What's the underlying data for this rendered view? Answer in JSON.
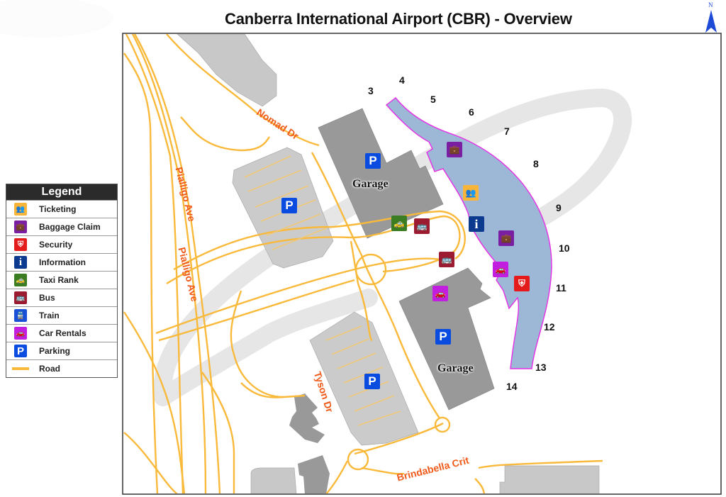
{
  "title": "Canberra International Airport (CBR) - Overview",
  "compass": {
    "label": "N",
    "icon": "north-arrow-icon"
  },
  "colors": {
    "road": "#f9b93a",
    "terminal_fill": "#9db8d6",
    "terminal_outline": "#e62ee6",
    "garage": "#999999",
    "parking_lot": "#cccccc",
    "road_label": "#f05a1a",
    "ticketing": "#f9b43a",
    "baggage": "#7a1fa2",
    "security": "#e31b1b",
    "information": "#0b3a8e",
    "taxi": "#3b7d23",
    "bus": "#9b1b30",
    "train": "#1a4fd8",
    "car_rental": "#c21ee0",
    "parking": "#0a4ce0"
  },
  "legend": {
    "title": "Legend",
    "items": [
      {
        "label": "Ticketing",
        "icon": "ticketing-icon",
        "glyph": "👥"
      },
      {
        "label": "Baggage Claim",
        "icon": "baggage-claim-icon",
        "glyph": "💼"
      },
      {
        "label": "Security",
        "icon": "security-icon",
        "glyph": "⛨"
      },
      {
        "label": "Information",
        "icon": "information-icon",
        "glyph": "i"
      },
      {
        "label": "Taxi Rank",
        "icon": "taxi-icon",
        "glyph": "🚕"
      },
      {
        "label": "Bus",
        "icon": "bus-icon",
        "glyph": "🚌"
      },
      {
        "label": "Train",
        "icon": "train-icon",
        "glyph": "🚆"
      },
      {
        "label": "Car Rentals",
        "icon": "car-rental-icon",
        "glyph": "🚗"
      },
      {
        "label": "Parking",
        "icon": "parking-icon",
        "glyph": "P"
      },
      {
        "label": "Road",
        "icon": "road-icon",
        "glyph": ""
      }
    ]
  },
  "gates": [
    "3",
    "4",
    "5",
    "6",
    "7",
    "8",
    "9",
    "10",
    "11",
    "12",
    "13",
    "14"
  ],
  "garages": [
    "Garage",
    "Garage"
  ],
  "roads": [
    "Nomad Dr",
    "Pialligo Ave",
    "Pialligo Ave",
    "Tyson Dr",
    "Brindabella Crit"
  ],
  "pois": [
    {
      "type": "parking",
      "glyph": "P"
    },
    {
      "type": "parking",
      "glyph": "P"
    },
    {
      "type": "parking",
      "glyph": "P"
    },
    {
      "type": "parking",
      "glyph": "P"
    },
    {
      "type": "baggage",
      "glyph": "💼"
    },
    {
      "type": "ticketing",
      "glyph": "👥"
    },
    {
      "type": "information",
      "glyph": "i"
    },
    {
      "type": "baggage",
      "glyph": "💼"
    },
    {
      "type": "car_rental",
      "glyph": "🚗"
    },
    {
      "type": "security",
      "glyph": "⛨"
    },
    {
      "type": "taxi",
      "glyph": "🚕"
    },
    {
      "type": "bus",
      "glyph": "🚌"
    },
    {
      "type": "bus",
      "glyph": "🚌"
    },
    {
      "type": "car_rental",
      "glyph": "🚗"
    }
  ]
}
